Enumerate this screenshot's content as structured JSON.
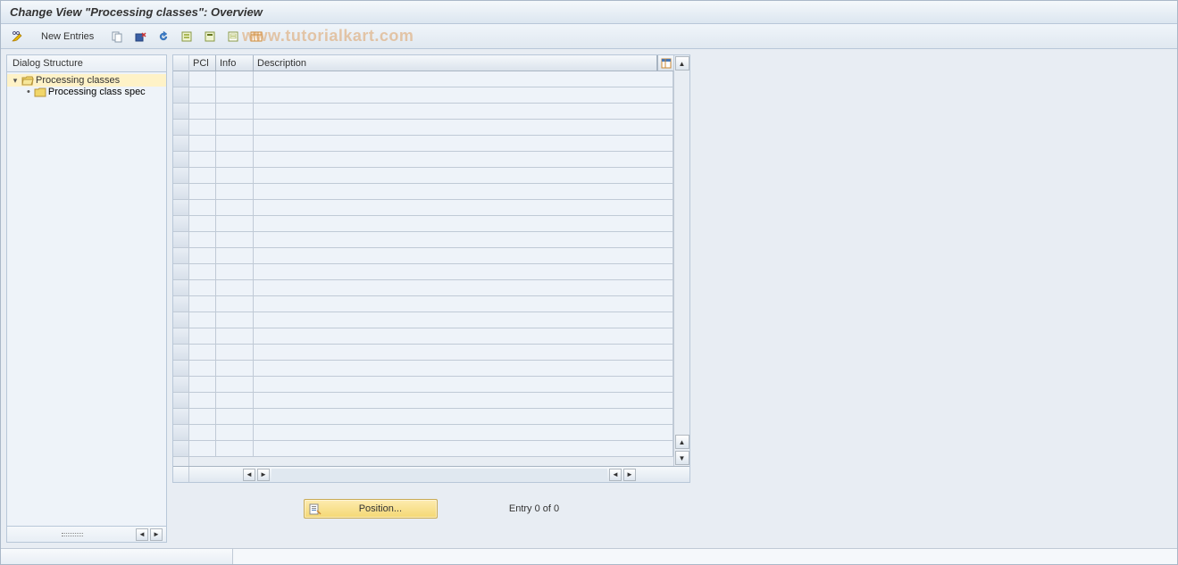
{
  "title": "Change View \"Processing classes\": Overview",
  "watermark": "www.tutorialkart.com",
  "toolbar": {
    "new_entries_label": "New Entries"
  },
  "sidebar": {
    "header": "Dialog Structure",
    "root": {
      "label": "Processing classes"
    },
    "child": {
      "label": "Processing class spec"
    }
  },
  "grid": {
    "columns": {
      "c1": "PCl",
      "c2": "Info",
      "c3": "Description"
    },
    "rows": []
  },
  "footer": {
    "position_label": "Position...",
    "entry_status": "Entry 0 of 0"
  }
}
